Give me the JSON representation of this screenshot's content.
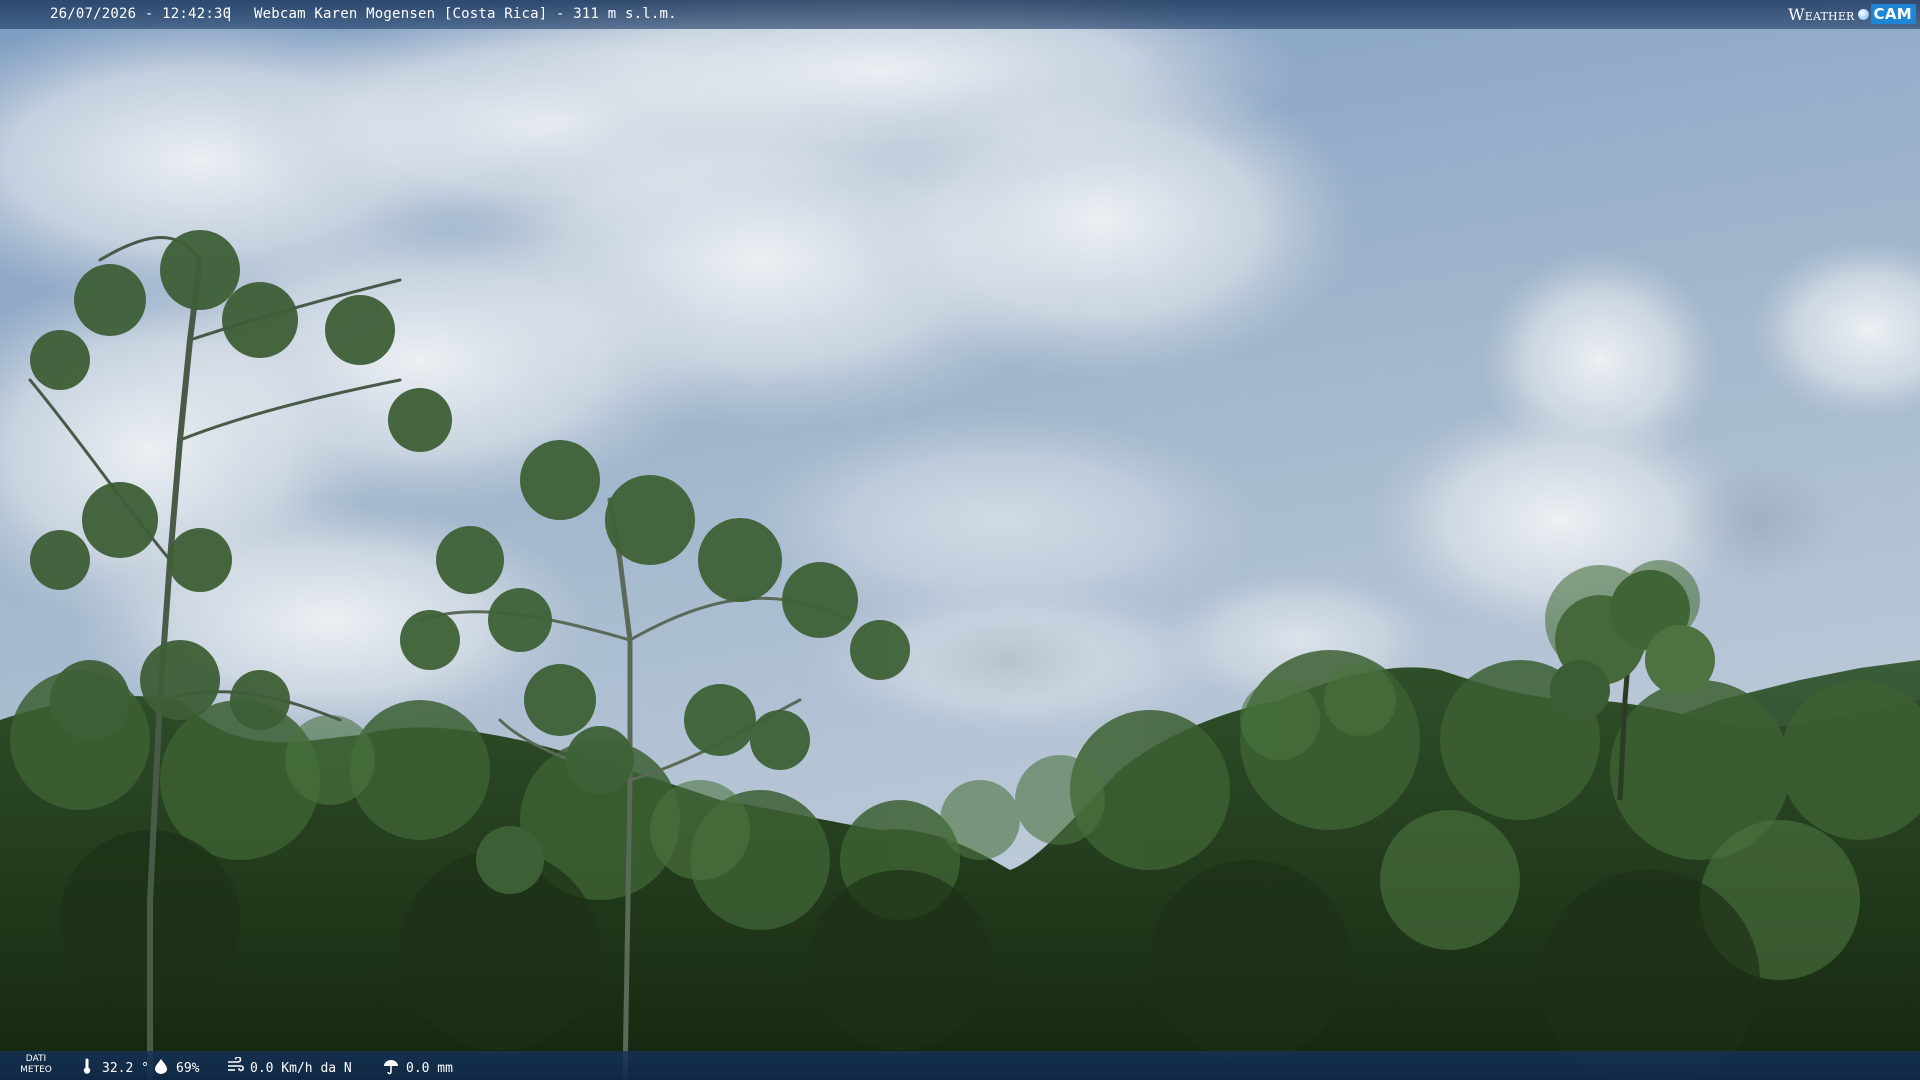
{
  "header": {
    "datetime": "26/07/2026 - 12:42:30",
    "separator": "|",
    "title": "Webcam Karen Mogensen [Costa Rica]  - 311 m s.l.m."
  },
  "brand": {
    "word": "Weather",
    "cam": "CAM"
  },
  "weather": {
    "label_line1": "DATI",
    "label_line2": "METEO",
    "temperature": "32.2 °",
    "humidity": "69%",
    "wind": "0.0 Km/h da N",
    "rain": "0.0 mm",
    "icons": [
      "thermometer-icon",
      "humidity-icon",
      "wind-icon",
      "rain-icon"
    ]
  },
  "colors": {
    "bar": "#1c3d6a",
    "brand_cam": "#1f86d6"
  }
}
